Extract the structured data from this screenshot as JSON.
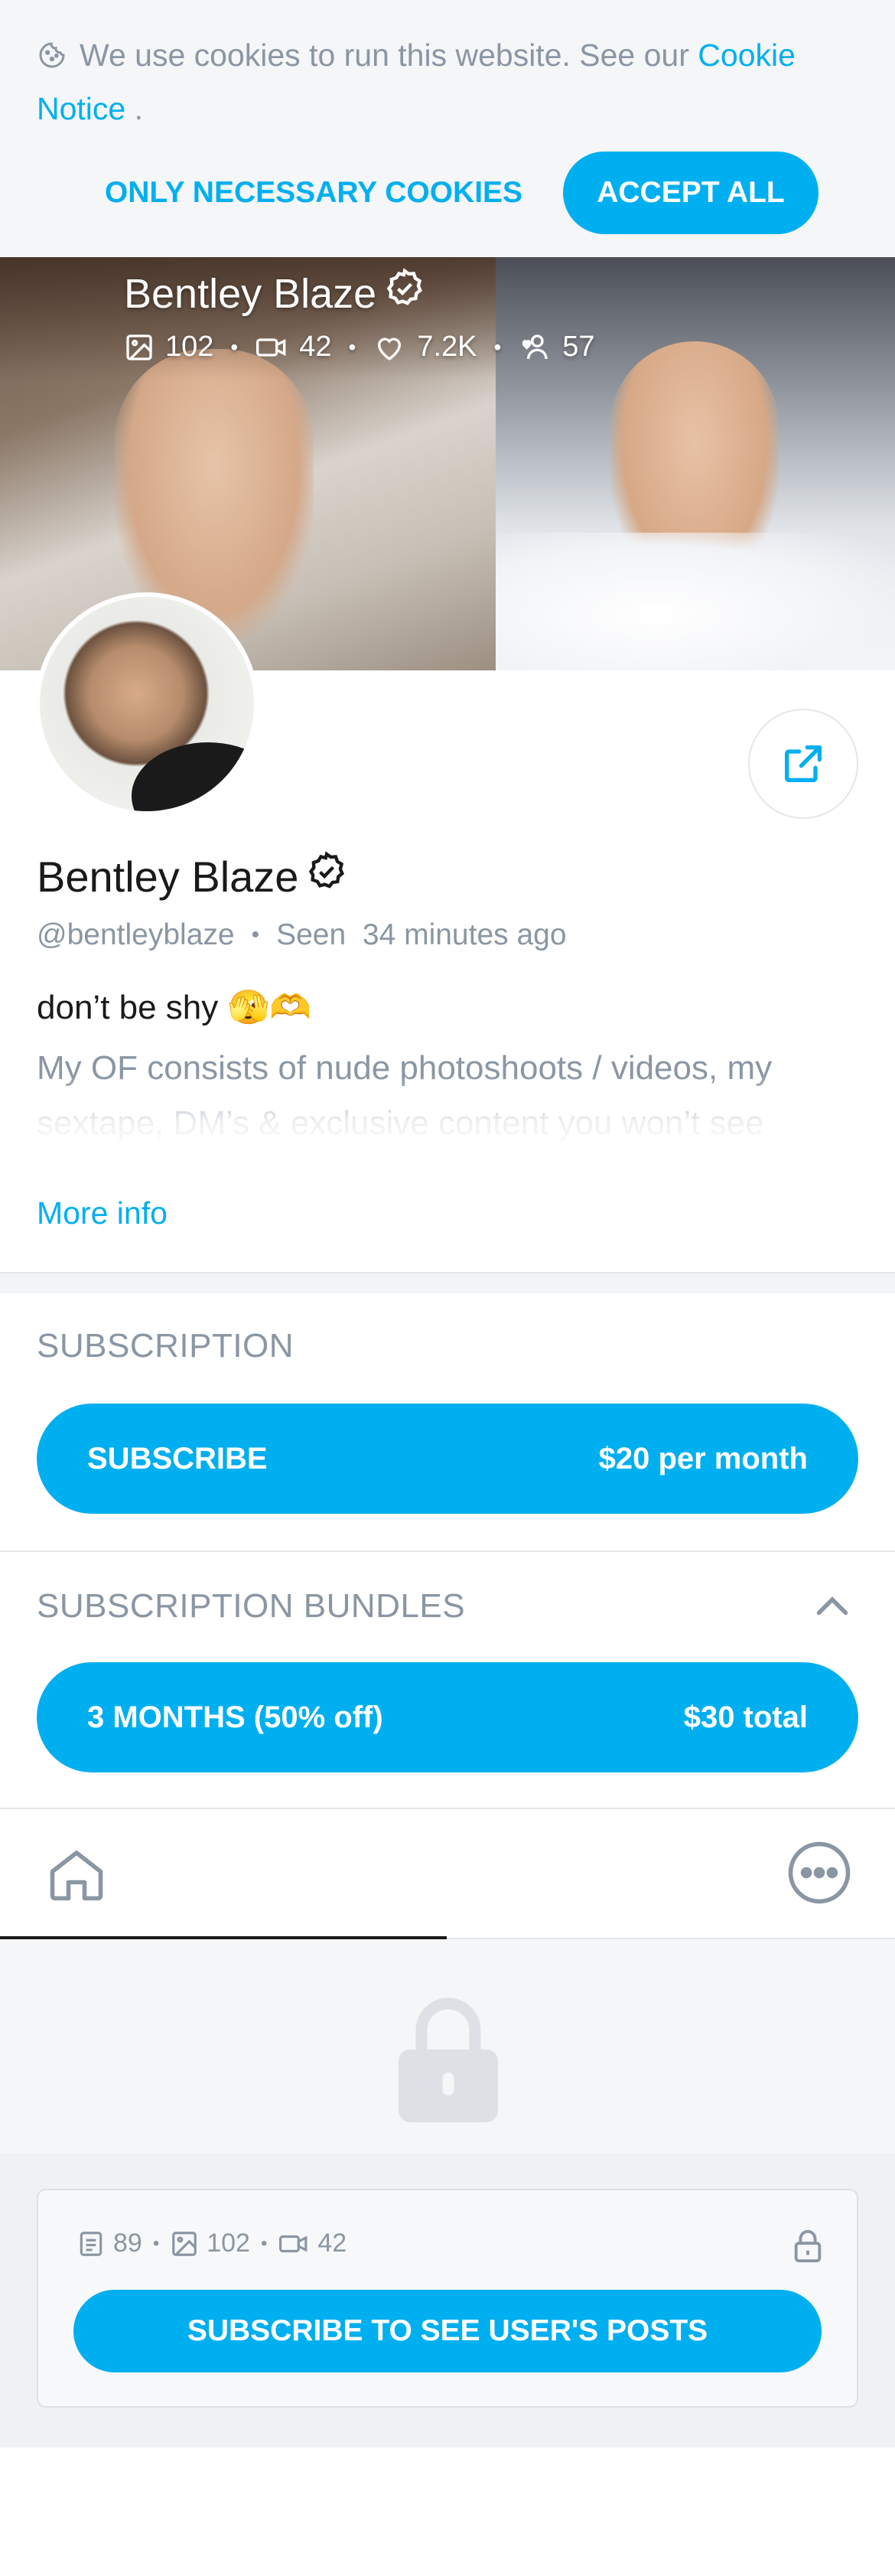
{
  "cookie": {
    "text": "We use cookies to run this website. See our",
    "link": "Cookie Notice",
    "suffix": ".",
    "necessary_label": "ONLY NECESSARY COOKIES",
    "accept_label": "ACCEPT ALL"
  },
  "cover": {
    "name": "Bentley Blaze",
    "stats": {
      "photos": "102",
      "videos": "42",
      "likes": "7.2K",
      "fans": "57"
    }
  },
  "profile": {
    "name": "Bentley Blaze",
    "handle": "@bentleyblaze",
    "seen_label": "Seen",
    "seen_time": "34 minutes ago",
    "bio_line1": "don’t be shy 🫣🫶",
    "bio_rest": "My OF consists of nude photoshoots / videos, my sextape, DM’s & exclusive content you won’t see anywhere else. You won’t regret it 🖤",
    "more_info": "More info"
  },
  "subscription": {
    "title": "SUBSCRIPTION",
    "subscribe_label": "SUBSCRIBE",
    "subscribe_price": "$20 per month"
  },
  "bundles": {
    "title": "SUBSCRIPTION BUNDLES",
    "bundle_label": "3 MONTHS (50% off)",
    "bundle_price": "$30 total"
  },
  "posts": {
    "counts": {
      "posts": "89",
      "photos": "102",
      "videos": "42"
    },
    "subscribe_label": "SUBSCRIBE TO SEE USER'S POSTS"
  },
  "colors": {
    "accent": "#00aff0",
    "muted": "#8a96a3",
    "text": "#1a1a1a"
  }
}
